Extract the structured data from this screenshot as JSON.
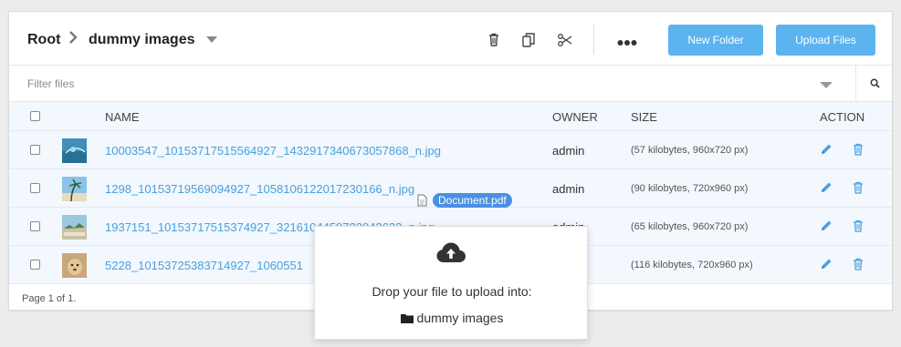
{
  "breadcrumb": {
    "root": "Root",
    "current": "dummy images"
  },
  "toolbar": {
    "new_folder_label": "New Folder",
    "upload_label": "Upload Files",
    "icons": [
      "trash-icon",
      "copy-icon",
      "scissors-icon",
      "more-icon"
    ]
  },
  "filter": {
    "placeholder": "Filter files"
  },
  "table": {
    "columns": {
      "name": "NAME",
      "owner": "OWNER",
      "size": "SIZE",
      "action": "ACTION"
    },
    "rows": [
      {
        "name": "10003547_10153717515564927_1432917340673057868_n.jpg",
        "owner": "admin",
        "size": "(57 kilobytes, 960x720 px)"
      },
      {
        "name": "1298_10153719569094927_1058106122017230166_n.jpg",
        "owner": "admin",
        "size": "(90 kilobytes, 720x960 px)"
      },
      {
        "name": "1937151_10153717515374927_3216104459733043632_n.jpg",
        "owner": "admin",
        "size": "(65 kilobytes, 960x720 px)"
      },
      {
        "name": "5228_10153725383714927_1060551",
        "owner": "",
        "size": "(116 kilobytes, 720x960 px)"
      }
    ]
  },
  "footer": {
    "pagination": "Page 1 of 1."
  },
  "drag": {
    "file_name": "Document.pdf"
  },
  "dropzone": {
    "message": "Drop your file to upload into:",
    "folder": "dummy images"
  },
  "colors": {
    "accent": "#5bb4f0",
    "link": "#4a9fe0",
    "row_bg": "#f2f8fd",
    "chip": "#4a90e2"
  }
}
